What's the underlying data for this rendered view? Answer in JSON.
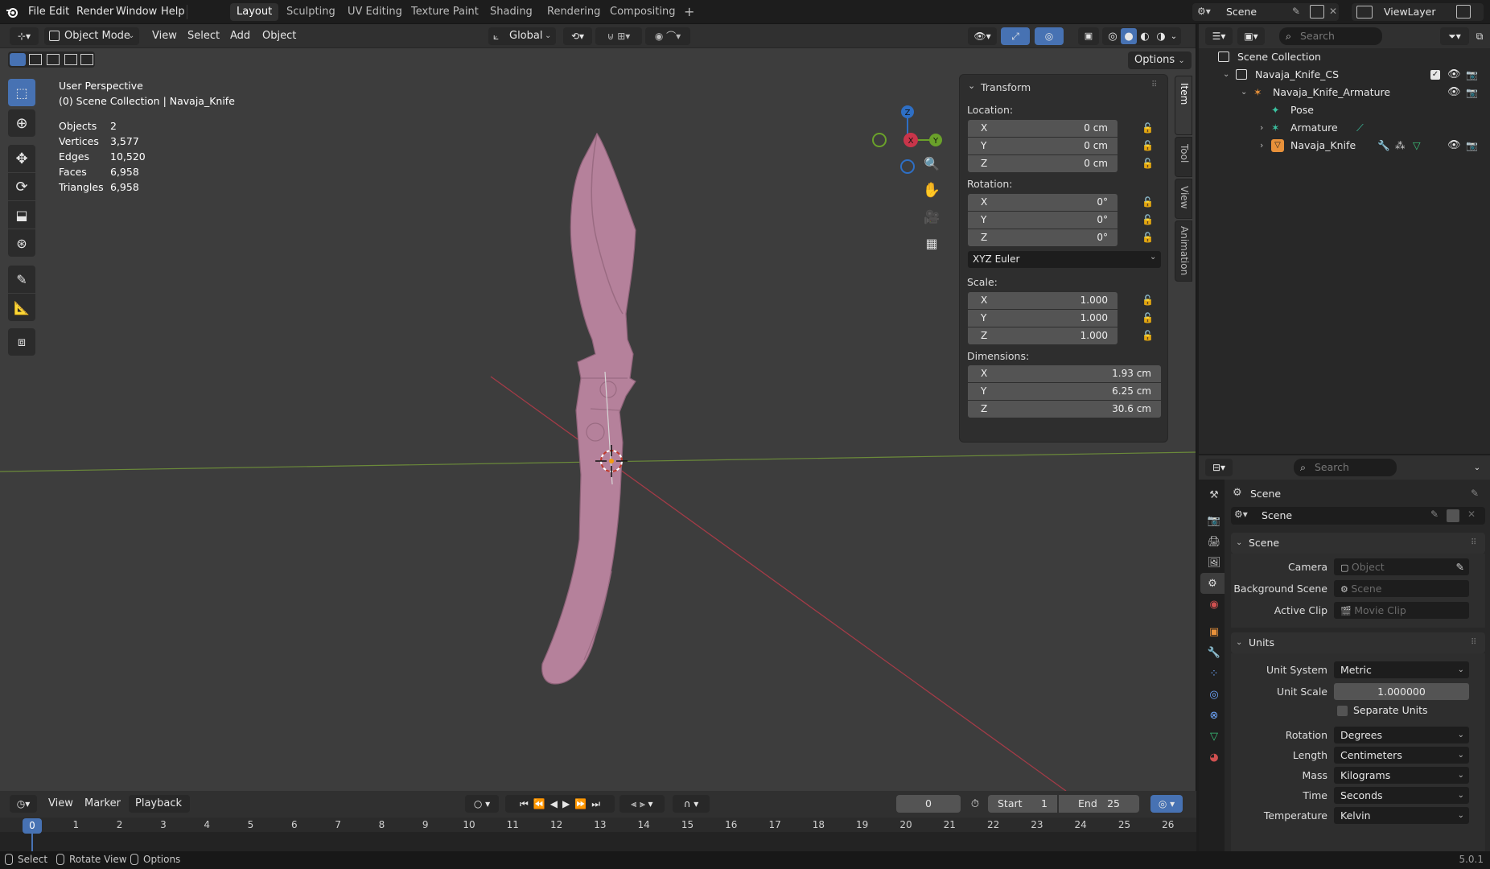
{
  "menu": [
    "File",
    "Edit",
    "Render",
    "Window",
    "Help"
  ],
  "workspaces": [
    {
      "label": "Layout",
      "active": true
    },
    {
      "label": "Sculpting",
      "active": false
    },
    {
      "label": "UV Editing",
      "active": false
    },
    {
      "label": "Texture Paint",
      "active": false
    },
    {
      "label": "Shading",
      "active": false
    },
    {
      "label": "Rendering",
      "active": false
    },
    {
      "label": "Compositing",
      "active": false
    }
  ],
  "add_workspace": "+",
  "scene_selector": "Scene",
  "viewlayer_selector": "ViewLayer",
  "viewport": {
    "mode": "Object Mode",
    "menus": [
      "View",
      "Select",
      "Add",
      "Object"
    ],
    "orientation": "Global",
    "options_label": "Options",
    "perspective": "User Perspective",
    "collection_path": "(0) Scene Collection | Navaja_Knife",
    "stats": [
      {
        "label": "Objects",
        "value": "2"
      },
      {
        "label": "Vertices",
        "value": "3,577"
      },
      {
        "label": "Edges",
        "value": "10,520"
      },
      {
        "label": "Faces",
        "value": "6,958"
      },
      {
        "label": "Triangles",
        "value": "6,958"
      }
    ],
    "gizmo": {
      "z": "Z",
      "x": "X",
      "y": "Y"
    },
    "side_tabs": [
      "Item",
      "Tool",
      "View",
      "Animation"
    ],
    "colors": {
      "background": "#3d3d3d",
      "knife": "#b5819b",
      "x_axis": "#a33b47",
      "y_axis": "#6b8a3a"
    }
  },
  "transform": {
    "title": "Transform",
    "location_label": "Location:",
    "location": [
      {
        "axis": "X",
        "value": "0 cm"
      },
      {
        "axis": "Y",
        "value": "0 cm"
      },
      {
        "axis": "Z",
        "value": "0 cm"
      }
    ],
    "rotation_label": "Rotation:",
    "rotation": [
      {
        "axis": "X",
        "value": "0°"
      },
      {
        "axis": "Y",
        "value": "0°"
      },
      {
        "axis": "Z",
        "value": "0°"
      }
    ],
    "rotation_mode": "XYZ Euler",
    "scale_label": "Scale:",
    "scale": [
      {
        "axis": "X",
        "value": "1.000"
      },
      {
        "axis": "Y",
        "value": "1.000"
      },
      {
        "axis": "Z",
        "value": "1.000"
      }
    ],
    "dimensions_label": "Dimensions:",
    "dimensions": [
      {
        "axis": "X",
        "value": "1.93 cm"
      },
      {
        "axis": "Y",
        "value": "6.25 cm"
      },
      {
        "axis": "Z",
        "value": "30.6 cm"
      }
    ]
  },
  "timeline": {
    "menus": [
      "View",
      "Marker"
    ],
    "playback": "Playback",
    "current_frame": "0",
    "start_label": "Start",
    "start_value": "1",
    "end_label": "End",
    "end_value": "25",
    "frames": [
      "0",
      "1",
      "2",
      "3",
      "4",
      "5",
      "6",
      "7",
      "8",
      "9",
      "10",
      "11",
      "12",
      "13",
      "14",
      "15",
      "16",
      "17",
      "18",
      "19",
      "20",
      "21",
      "22",
      "23",
      "24",
      "25",
      "26"
    ]
  },
  "statusbar": {
    "select": "Select",
    "rotate": "Rotate View",
    "options": "Options",
    "version": "5.0.1"
  },
  "outliner": {
    "search_placeholder": "Search",
    "root": "Scene Collection",
    "items": [
      {
        "label": "Navaja_Knife_CS",
        "depth": 1
      },
      {
        "label": "Navaja_Knife_Armature",
        "depth": 2
      },
      {
        "label": "Pose",
        "depth": 3
      },
      {
        "label": "Armature",
        "depth": 3
      },
      {
        "label": "Navaja_Knife",
        "depth": 3
      }
    ]
  },
  "properties": {
    "search_placeholder": "Search",
    "context_title": "Scene",
    "scene_name": "Scene",
    "scene_section": "Scene",
    "camera_label": "Camera",
    "camera_placeholder": "Object",
    "bgscene_label": "Background Scene",
    "bgscene_placeholder": "Scene",
    "clip_label": "Active Clip",
    "clip_placeholder": "Movie Clip",
    "units_section": "Units",
    "unit_system_label": "Unit System",
    "unit_system": "Metric",
    "unit_scale_label": "Unit Scale",
    "unit_scale": "1.000000",
    "separate_units": "Separate Units",
    "rotation_label": "Rotation",
    "rotation": "Degrees",
    "length_label": "Length",
    "length": "Centimeters",
    "mass_label": "Mass",
    "mass": "Kilograms",
    "time_label": "Time",
    "time": "Seconds",
    "temperature_label": "Temperature",
    "temperature": "Kelvin"
  }
}
